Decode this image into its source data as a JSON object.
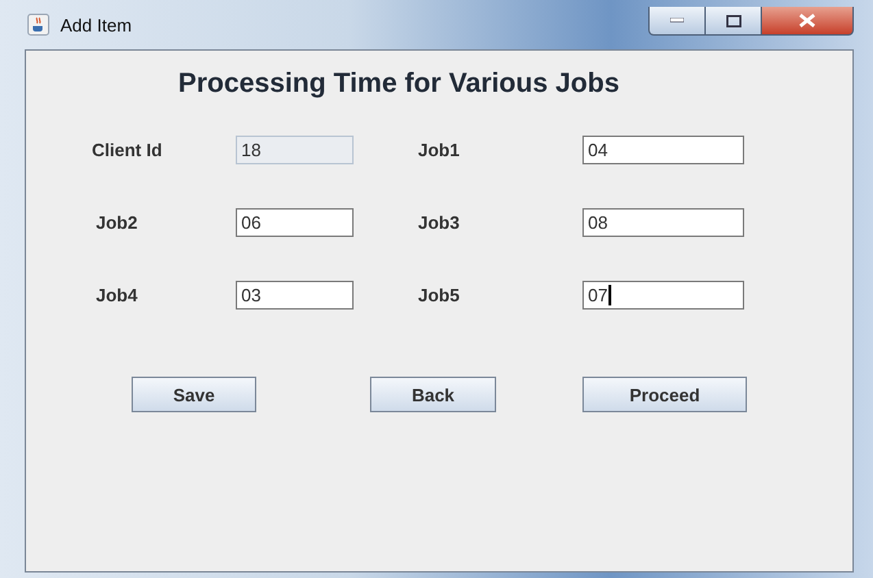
{
  "window": {
    "title": "Add Item"
  },
  "heading": "Processing Time for Various Jobs",
  "fields": [
    {
      "label": "Client Id",
      "value": "18",
      "disabled": true,
      "focused": false
    },
    {
      "label": "Job1",
      "value": "04",
      "disabled": false,
      "focused": false
    },
    {
      "label": "Job2",
      "value": "06",
      "disabled": false,
      "focused": false
    },
    {
      "label": "Job3",
      "value": "08",
      "disabled": false,
      "focused": false
    },
    {
      "label": "Job4",
      "value": "03",
      "disabled": false,
      "focused": false
    },
    {
      "label": "Job5",
      "value": "07",
      "disabled": false,
      "focused": true
    }
  ],
  "buttons": [
    "Save",
    "Back",
    "Proceed"
  ]
}
